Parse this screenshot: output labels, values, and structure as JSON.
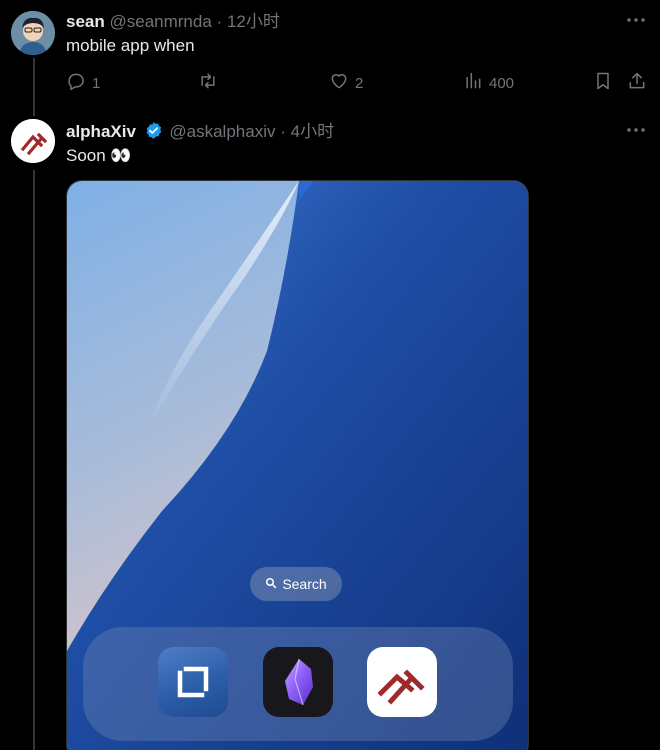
{
  "tweets": [
    {
      "name": "sean",
      "handle": "@seanmrnda",
      "separator": "·",
      "time": "12小时",
      "text": "mobile app when",
      "actions": {
        "reply_count": "1",
        "retweet_count": "",
        "like_count": "2",
        "views_count": "400"
      },
      "icons": [
        "reply-icon",
        "retweet-icon",
        "like-icon",
        "views-icon",
        "bookmark-icon",
        "share-icon",
        "more-icon"
      ]
    },
    {
      "name": "alphaXiv",
      "handle": "@askalphaxiv",
      "separator": "·",
      "time": "4小时",
      "text": "Soon 👀",
      "verified": true,
      "media": {
        "search_label": "Search",
        "dock_apps": [
          "app-icon-blue-frame",
          "obsidian-app-icon",
          "alphaxiv-app-icon"
        ]
      }
    }
  ],
  "colors": {
    "background": "#000000",
    "text": "#e7e9ea",
    "muted": "#71767b",
    "verified": "#1d9bf0",
    "alphaxiv_red": "#9e2a2b"
  }
}
